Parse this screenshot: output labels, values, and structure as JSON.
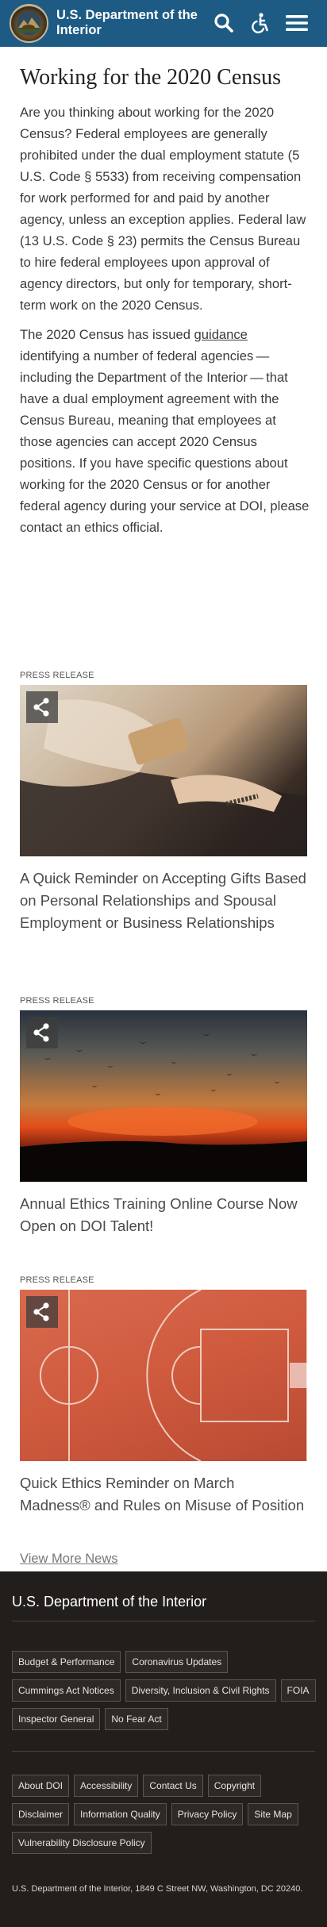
{
  "header": {
    "site_title": "U.S. Department of the Interior",
    "brand_color": "#1d5b84",
    "icons": [
      "search-icon",
      "accessibility-icon",
      "menu-icon"
    ]
  },
  "article": {
    "title": "Working for the 2020 Census",
    "paragraph1": "Are you thinking about working for the 2020 Census?  Federal employees are generally prohibited under the dual employment statute (5 U.S. Code § 5533) from receiving compensation for work performed for and paid by another agency, unless an exception applies. Federal law (13 U.S. Code § 23) permits the Census Bureau to hire federal employees upon approval of agency directors, but only for temporary, short-term work on the 2020 Census.",
    "paragraph2_before": "The 2020 Census has issued ",
    "paragraph2_link": "guidance",
    "paragraph2_after": " identifying a number of federal agencies — including the Department of the Interior — that have a dual employment agreement with the Census Bureau, meaning that employees at those agencies can accept 2020 Census positions. If you have specific questions about working for the 2020 Census or for another federal agency during your service at DOI, please contact an ethics official."
  },
  "news": [
    {
      "kicker": "PRESS RELEASE",
      "title": "A Quick Reminder on Accepting Gifts Based on Personal Relationships and Spousal Employment or Business Relationships"
    },
    {
      "kicker": "PRESS RELEASE",
      "title": "Annual Ethics Training Online Course Now Open on DOI Talent!"
    },
    {
      "kicker": "PRESS RELEASE",
      "title": "Quick Ethics Reminder on March Madness® and Rules on Misuse of Position"
    }
  ],
  "view_more": "View More News",
  "footer": {
    "title": "U.S. Department of the Interior",
    "group1": [
      "Budget & Performance",
      "Coronavirus Updates",
      "Cummings Act Notices",
      "Diversity, Inclusion & Civil Rights",
      "FOIA",
      "Inspector General",
      "No Fear Act"
    ],
    "group2": [
      "About DOI",
      "Accessibility",
      "Contact Us",
      "Copyright",
      "Disclaimer",
      "Information Quality",
      "Privacy Policy",
      "Site Map",
      "Vulnerability Disclosure Policy"
    ],
    "address": "U.S. Department of the Interior, 1849 C Street NW, Washington, DC 20240."
  }
}
